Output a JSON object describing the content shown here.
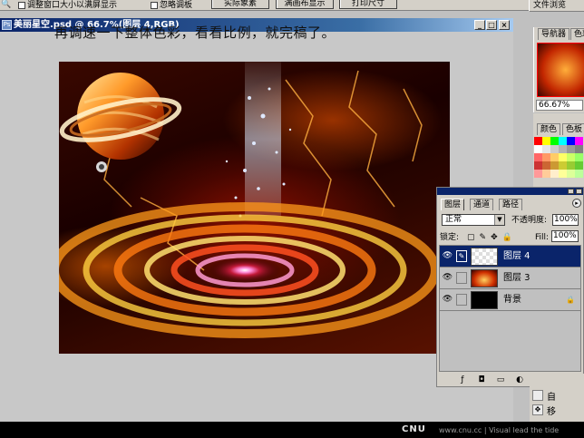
{
  "options_bar": {
    "resize_checkbox_label": "调整窗口大小以满屏显示",
    "ignore_palettes_label": "忽略调板",
    "btn_actual_pixels": "实际象素",
    "btn_fit_screen": "满画布显示",
    "btn_print_size": "打印尺寸",
    "file_browser_tab": "文件浏览"
  },
  "document": {
    "title": "美丽星空.psd @ 66.7%(图层 4,RGB)",
    "doc_icon": "Ps",
    "btn_minimize": "_",
    "btn_maximize": "□",
    "btn_close": "×",
    "caption": "再调速一下整体色彩，看看比例，就完稿了。"
  },
  "navigator": {
    "tab_navigator": "导航器",
    "tab_color": "色彩",
    "zoom": "66.67%"
  },
  "swatches": {
    "tab_color": "颜色",
    "tab_swatches": "色板",
    "colors": [
      "#ff0000",
      "#ffff00",
      "#00ff00",
      "#00ffff",
      "#0000ff",
      "#ff00ff",
      "#ffffff",
      "#e6e6e6",
      "#cccccc",
      "#b3b3b3",
      "#999999",
      "#808080",
      "#ff6666",
      "#ff9966",
      "#ffcc66",
      "#ffff66",
      "#ccff66",
      "#99ff66",
      "#cc3333",
      "#cc6633",
      "#cc9933",
      "#cccc33",
      "#99cc33",
      "#66cc33",
      "#ff9999",
      "#ffcc99",
      "#ffeecc",
      "#ffff99",
      "#ddff99",
      "#bbff99"
    ]
  },
  "layers_panel": {
    "tab_layers": "图层",
    "tab_channels": "通道",
    "tab_paths": "路径",
    "menu_icon": "▸",
    "blend_mode": "正常",
    "opacity_label": "不透明度:",
    "opacity_value": "100%",
    "lock_label": "锁定:",
    "fill_label": "Fill:",
    "fill_value": "100%",
    "layers": [
      {
        "name": "图层 4",
        "selected": true
      },
      {
        "name": "图层 3",
        "selected": false
      },
      {
        "name": "背景",
        "selected": false,
        "locked": true
      }
    ]
  },
  "history": {
    "item1": "自",
    "item2": "移"
  },
  "footer": {
    "brand": "CNU",
    "tagline": "www.cnu.cc | Visual lead the tide"
  }
}
